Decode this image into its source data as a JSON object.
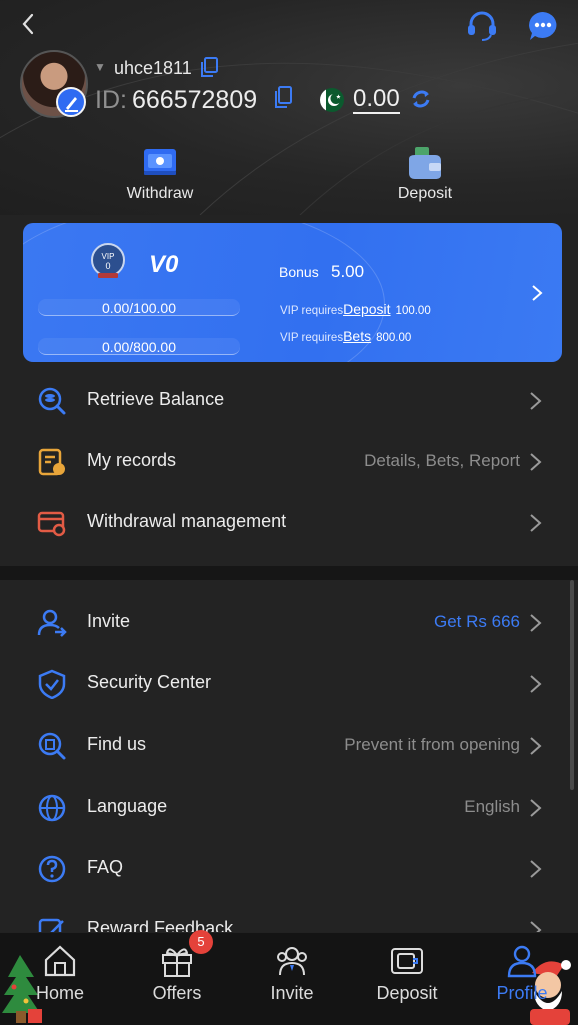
{
  "header": {
    "username": "uhce1811",
    "id_label": "ID:",
    "id_value": "666572809",
    "balance": "0.00"
  },
  "quick_actions": [
    {
      "label": "Withdraw",
      "icon": "withdraw-icon"
    },
    {
      "label": "Deposit",
      "icon": "wallet-icon"
    }
  ],
  "vip": {
    "level": "V0",
    "badge_text": "VIP",
    "badge_number": "0",
    "deposit_progress": "0.00/100.00",
    "bets_progress": "0.00/800.00",
    "bonus_label": "Bonus",
    "bonus_value": "5.00",
    "req1_prefix": "VIP requires",
    "req1_link": "Deposit",
    "req1_amount": "100.00",
    "req2_prefix": "VIP requires",
    "req2_link": "Bets",
    "req2_amount": "800.00"
  },
  "menu_group1": [
    {
      "label": "Retrieve Balance",
      "right": "",
      "icon": "retrieve-balance-icon"
    },
    {
      "label": "My records",
      "right": "Details, Bets, Report",
      "icon": "records-icon"
    },
    {
      "label": "Withdrawal management",
      "right": "",
      "icon": "withdrawal-management-icon"
    }
  ],
  "menu_group2": [
    {
      "label": "Invite",
      "right": "Get Rs 666",
      "icon": "invite-user-icon"
    },
    {
      "label": "Security Center",
      "right": "",
      "icon": "shield-icon"
    },
    {
      "label": "Find us",
      "right": "Prevent it from opening",
      "icon": "find-us-icon"
    },
    {
      "label": "Language",
      "right": "English",
      "icon": "globe-icon"
    },
    {
      "label": "FAQ",
      "right": "",
      "icon": "question-icon"
    },
    {
      "label": "Reward Feedback",
      "right": "",
      "icon": "feedback-icon"
    }
  ],
  "bottom_nav": [
    {
      "label": "Home",
      "icon": "home-icon"
    },
    {
      "label": "Offers",
      "icon": "gift-icon"
    },
    {
      "label": "Invite",
      "icon": "invite-icon"
    },
    {
      "label": "Deposit",
      "icon": "deposit-icon"
    },
    {
      "label": "Profile",
      "icon": "profile-icon"
    }
  ],
  "offers_badge": "5",
  "colors": {
    "accent": "#3c7bf4",
    "vip_card": "#3270f0",
    "background": "#232323",
    "badge": "#e4423a"
  }
}
